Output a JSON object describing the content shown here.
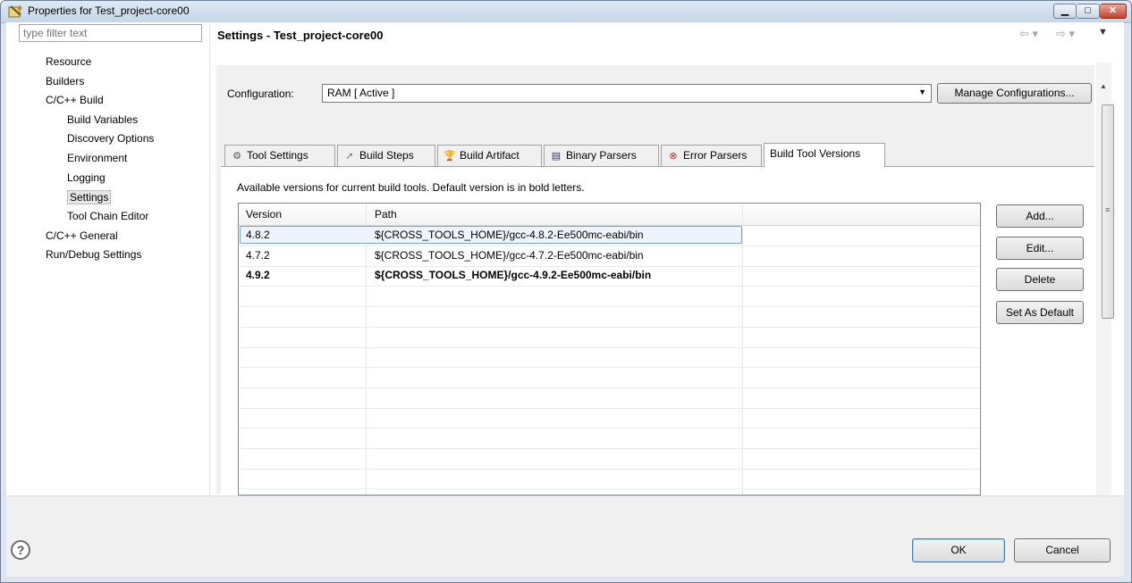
{
  "window": {
    "title": "Properties for Test_project-core00",
    "controls": {
      "minimize": "▁",
      "maximize": "□",
      "close": "✕"
    }
  },
  "sidebar": {
    "filter_placeholder": "type filter text",
    "items": [
      {
        "label": "Resource",
        "level": 0
      },
      {
        "label": "Builders",
        "level": 0
      },
      {
        "label": "C/C++ Build",
        "level": 0
      },
      {
        "label": "Build Variables",
        "level": 1
      },
      {
        "label": "Discovery Options",
        "level": 1
      },
      {
        "label": "Environment",
        "level": 1
      },
      {
        "label": "Logging",
        "level": 1
      },
      {
        "label": "Settings",
        "level": 1,
        "selected": true
      },
      {
        "label": "Tool Chain Editor",
        "level": 1
      },
      {
        "label": "C/C++ General",
        "level": 0
      },
      {
        "label": "Run/Debug Settings",
        "level": 0
      }
    ]
  },
  "page": {
    "title": "Settings - Test_project-core00",
    "nav_icons": [
      "back-arrow-icon",
      "forward-arrow-icon",
      "view-menu-icon"
    ],
    "configuration_label": "Configuration:",
    "configuration_value": "RAM  [ Active ]",
    "manage_button": "Manage Configurations..."
  },
  "tabs": [
    {
      "label": "Tool Settings",
      "icon": "tool-settings-icon"
    },
    {
      "label": "Build Steps",
      "icon": "build-steps-icon"
    },
    {
      "label": "Build Artifact",
      "icon": "build-artifact-icon"
    },
    {
      "label": "Binary Parsers",
      "icon": "binary-parsers-icon"
    },
    {
      "label": "Error Parsers",
      "icon": "error-parsers-icon"
    },
    {
      "label": "Build Tool Versions",
      "active": true
    }
  ],
  "versions_panel": {
    "hint": "Available versions for current build tools. Default version is in bold letters.",
    "columns": [
      "Version",
      "Path"
    ],
    "rows": [
      {
        "version": "4.8.2",
        "path": "${CROSS_TOOLS_HOME}/gcc-4.8.2-Ee500mc-eabi/bin",
        "selected": true,
        "default": false
      },
      {
        "version": "4.7.2",
        "path": "${CROSS_TOOLS_HOME}/gcc-4.7.2-Ee500mc-eabi/bin",
        "selected": false,
        "default": false
      },
      {
        "version": "4.9.2",
        "path": "${CROSS_TOOLS_HOME}/gcc-4.9.2-Ee500mc-eabi/bin",
        "selected": false,
        "default": true
      }
    ],
    "buttons": {
      "add": "Add...",
      "edit": "Edit...",
      "delete": "Delete",
      "set_default": "Set As Default"
    }
  },
  "footer": {
    "ok": "OK",
    "cancel": "Cancel",
    "help_icon": "?"
  }
}
